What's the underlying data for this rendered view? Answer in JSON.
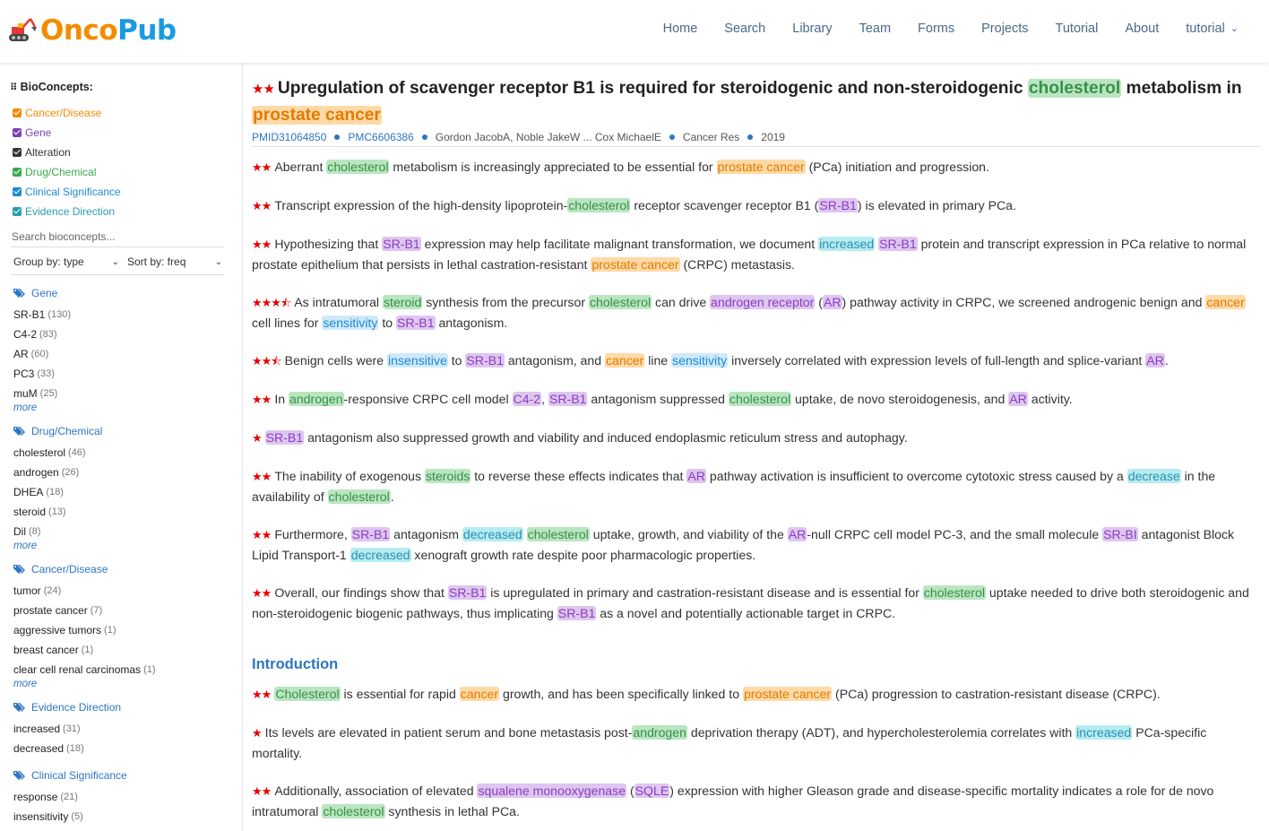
{
  "header": {
    "logo": {
      "part1": "Onco",
      "part2": "Pub"
    },
    "nav": [
      "Home",
      "Search",
      "Library",
      "Team",
      "Forms",
      "Projects",
      "Tutorial",
      "About",
      "tutorial"
    ]
  },
  "sidebar": {
    "bioconcepts_title": "BioConcepts:",
    "bioconcepts": [
      {
        "label": "Cancer/Disease",
        "color": "#f28c00"
      },
      {
        "label": "Gene",
        "color": "#7c3fb5"
      },
      {
        "label": "Alteration",
        "color": "#333333"
      },
      {
        "label": "Drug/Chemical",
        "color": "#3aaa4a"
      },
      {
        "label": "Clinical Significance",
        "color": "#1f8ad0"
      },
      {
        "label": "Evidence Direction",
        "color": "#2b9bb0"
      }
    ],
    "search_placeholder": "Search bioconcepts...",
    "group_by": "Group by: type",
    "sort_by": "Sort by: freq",
    "more_label": "more",
    "groups": [
      {
        "title": "Gene",
        "items": [
          [
            "SR-B1",
            "(130)"
          ],
          [
            "C4-2",
            "(83)"
          ],
          [
            "AR",
            "(60)"
          ],
          [
            "PC3",
            "(33)"
          ],
          [
            "muM",
            "(25)"
          ]
        ],
        "more": true
      },
      {
        "title": "Drug/Chemical",
        "items": [
          [
            "cholesterol",
            "(46)"
          ],
          [
            "androgen",
            "(26)"
          ],
          [
            "DHEA",
            "(18)"
          ],
          [
            "steroid",
            "(13)"
          ],
          [
            "Dil",
            "(8)"
          ]
        ],
        "more": true
      },
      {
        "title": "Cancer/Disease",
        "items": [
          [
            "tumor",
            "(24)"
          ],
          [
            "prostate cancer",
            "(7)"
          ],
          [
            "aggressive tumors",
            "(1)"
          ],
          [
            "breast cancer",
            "(1)"
          ],
          [
            "clear cell renal carcinomas",
            "(1)"
          ]
        ],
        "more": true
      },
      {
        "title": "Evidence Direction",
        "items": [
          [
            "increased",
            "(31)"
          ],
          [
            "decreased",
            "(18)"
          ]
        ],
        "more": false
      },
      {
        "title": "Clinical Significance",
        "items": [
          [
            "response",
            "(21)"
          ],
          [
            "insensitivity",
            "(5)"
          ]
        ],
        "more": false
      }
    ]
  },
  "article": {
    "title": [
      [
        "t",
        "Upregulation of scavenger receptor B1 is required for steroidogenic and non-steroidogenic "
      ],
      [
        "chem",
        "cholesterol"
      ],
      [
        "t",
        " metabolism in "
      ],
      [
        "canc",
        "prostate cancer"
      ]
    ],
    "title_stars": "★★",
    "meta": {
      "pmid": "PMID31064850",
      "pmc": "PMC6606386",
      "authors": "Gordon JacobA, Noble JakeW ... Cox MichaelE",
      "journal": "Cancer Res",
      "year": "2019"
    },
    "introduction_heading": "Introduction",
    "paragraphs": [
      {
        "stars": "★★",
        "segments": [
          [
            "t",
            "Aberrant "
          ],
          [
            "chem",
            "cholesterol"
          ],
          [
            "t",
            " metabolism is increasingly appreciated to be essential for "
          ],
          [
            "canc",
            "prostate cancer"
          ],
          [
            "t",
            " (PCa) initiation and progression."
          ]
        ]
      },
      {
        "stars": "★★",
        "segments": [
          [
            "t",
            "Transcript expression of the high-density lipoprotein-"
          ],
          [
            "chem",
            "cholesterol"
          ],
          [
            "t",
            " receptor scavenger receptor B1 ("
          ],
          [
            "gene",
            "SR-B1"
          ],
          [
            "t",
            ") is elevated in primary PCa."
          ]
        ]
      },
      {
        "stars": "★★",
        "segments": [
          [
            "t",
            "Hypothesizing that "
          ],
          [
            "gene",
            "SR-B1"
          ],
          [
            "t",
            " expression may help facilitate malignant transformation, we document "
          ],
          [
            "evid",
            "increased"
          ],
          [
            "t",
            " "
          ],
          [
            "gene",
            "SR-B1"
          ],
          [
            "t",
            " protein and transcript expression in PCa relative to normal prostate epithelium that persists in lethal castration-resistant "
          ],
          [
            "canc",
            "prostate cancer"
          ],
          [
            "t",
            " (CRPC) metastasis."
          ]
        ]
      },
      {
        "stars": "★★★⯪",
        "segments": [
          [
            "t",
            "As intratumoral "
          ],
          [
            "chem",
            "steroid"
          ],
          [
            "t",
            " synthesis from the precursor "
          ],
          [
            "chem",
            "cholesterol"
          ],
          [
            "t",
            " can drive "
          ],
          [
            "gene",
            "androgen receptor"
          ],
          [
            "t",
            " ("
          ],
          [
            "gene",
            "AR"
          ],
          [
            "t",
            ") pathway activity in CRPC, we screened androgenic benign and "
          ],
          [
            "canc",
            "cancer"
          ],
          [
            "t",
            " cell lines for "
          ],
          [
            "clin",
            "sensitivity"
          ],
          [
            "t",
            " to "
          ],
          [
            "gene",
            "SR-B1"
          ],
          [
            "t",
            " antagonism."
          ]
        ]
      },
      {
        "stars": "★★⯪",
        "segments": [
          [
            "t",
            "Benign cells were "
          ],
          [
            "clin",
            "insensitive"
          ],
          [
            "t",
            " to "
          ],
          [
            "gene",
            "SR-B1"
          ],
          [
            "t",
            " antagonism, and "
          ],
          [
            "canc",
            "cancer"
          ],
          [
            "t",
            " line "
          ],
          [
            "clin",
            "sensitivity"
          ],
          [
            "t",
            " inversely correlated with expression levels of full-length and splice-variant "
          ],
          [
            "gene",
            "AR"
          ],
          [
            "t",
            "."
          ]
        ]
      },
      {
        "stars": "★★",
        "segments": [
          [
            "t",
            "In "
          ],
          [
            "chem",
            "androgen"
          ],
          [
            "t",
            "-responsive CRPC cell model "
          ],
          [
            "gene",
            "C4-2"
          ],
          [
            "t",
            ", "
          ],
          [
            "gene",
            "SR-B1"
          ],
          [
            "t",
            " antagonism suppressed "
          ],
          [
            "chem",
            "cholesterol"
          ],
          [
            "t",
            " uptake, de novo steroidogenesis, and "
          ],
          [
            "gene",
            "AR"
          ],
          [
            "t",
            " activity."
          ]
        ]
      },
      {
        "stars": "★",
        "segments": [
          [
            "gene",
            "SR-B1"
          ],
          [
            "t",
            " antagonism also suppressed growth and viability and induced endoplasmic reticulum stress and autophagy."
          ]
        ]
      },
      {
        "stars": "★★",
        "segments": [
          [
            "t",
            "The inability of exogenous "
          ],
          [
            "chem",
            "steroids"
          ],
          [
            "t",
            " to reverse these effects indicates that "
          ],
          [
            "gene",
            "AR"
          ],
          [
            "t",
            " pathway activation is insufficient to overcome cytotoxic stress caused by a "
          ],
          [
            "evid",
            "decrease"
          ],
          [
            "t",
            " in the availability of "
          ],
          [
            "chem",
            "cholesterol"
          ],
          [
            "t",
            "."
          ]
        ]
      },
      {
        "stars": "★★",
        "segments": [
          [
            "t",
            "Furthermore, "
          ],
          [
            "gene",
            "SR-B1"
          ],
          [
            "t",
            " antagonism "
          ],
          [
            "evid",
            "decreased"
          ],
          [
            "t",
            " "
          ],
          [
            "chem",
            "cholesterol"
          ],
          [
            "t",
            " uptake, growth, and viability of the "
          ],
          [
            "gene",
            "AR"
          ],
          [
            "t",
            "-null CRPC cell model PC-3, and the small molecule "
          ],
          [
            "gene",
            "SR-BI"
          ],
          [
            "t",
            " antagonist Block Lipid Transport-1 "
          ],
          [
            "evid",
            "decreased"
          ],
          [
            "t",
            " xenograft growth rate despite poor pharmacologic properties."
          ]
        ]
      },
      {
        "stars": "★★",
        "segments": [
          [
            "t",
            "Overall, our findings show that "
          ],
          [
            "gene",
            "SR-B1"
          ],
          [
            "t",
            " is upregulated in primary and castration-resistant disease and is essential for "
          ],
          [
            "chem",
            "cholesterol"
          ],
          [
            "t",
            " uptake needed to drive both steroidogenic and non-steroidogenic biogenic pathways, thus implicating "
          ],
          [
            "gene",
            "SR-B1"
          ],
          [
            "t",
            " as a novel and potentially actionable target in CRPC."
          ]
        ]
      },
      {
        "stars": "★★",
        "segments": [
          [
            "chem",
            "Cholesterol"
          ],
          [
            "t",
            " is essential for rapid "
          ],
          [
            "canc",
            "cancer"
          ],
          [
            "t",
            " growth, and has been specifically linked to "
          ],
          [
            "canc",
            "prostate cancer"
          ],
          [
            "t",
            " (PCa) progression to castration-resistant disease (CRPC)."
          ]
        ]
      },
      {
        "stars": "★",
        "segments": [
          [
            "t",
            "Its levels are elevated in patient serum and bone metastasis post-"
          ],
          [
            "chem",
            "androgen"
          ],
          [
            "t",
            " deprivation therapy (ADT), and hypercholesterolemia correlates with "
          ],
          [
            "evid",
            "increased"
          ],
          [
            "t",
            " PCa-specific mortality."
          ]
        ]
      },
      {
        "stars": "★★",
        "segments": [
          [
            "t",
            "Additionally, association of elevated "
          ],
          [
            "gene",
            "squalene monooxygenase"
          ],
          [
            "t",
            " ("
          ],
          [
            "gene",
            "SQLE"
          ],
          [
            "t",
            ") expression with higher Gleason grade and disease-specific mortality indicates a role for de novo intratumoral "
          ],
          [
            "chem",
            "cholesterol"
          ],
          [
            "t",
            " synthesis in lethal PCa."
          ]
        ]
      }
    ]
  }
}
